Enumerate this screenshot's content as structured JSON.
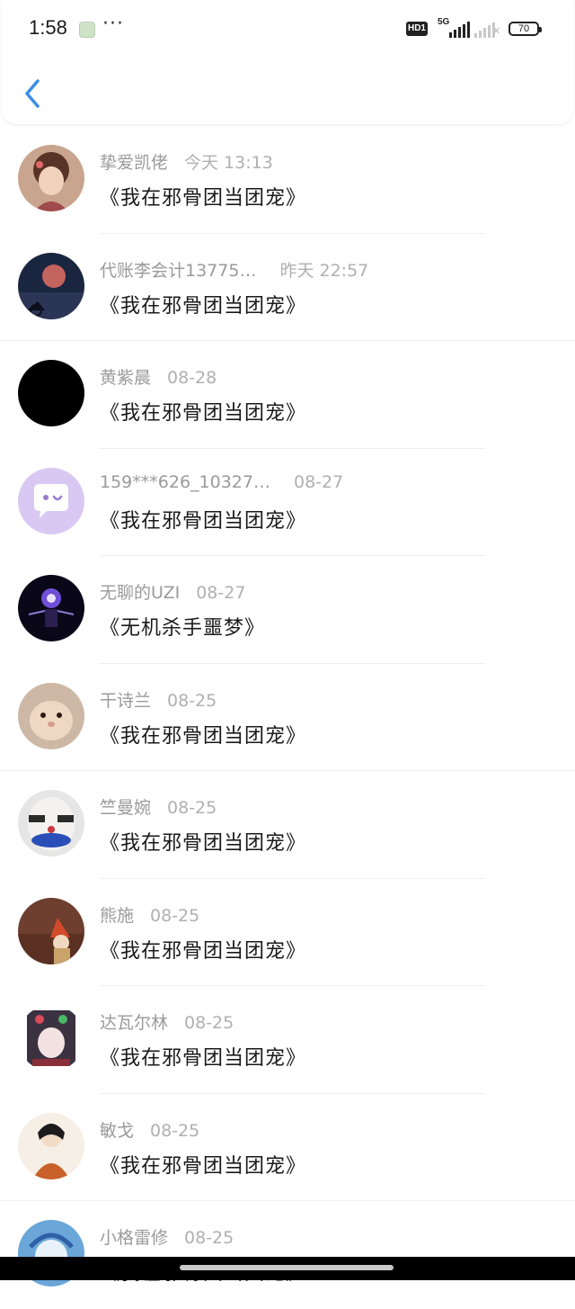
{
  "status_bar": {
    "time": "1:58",
    "dots": "···",
    "hd_label": "HD1",
    "network": "5G",
    "battery": "70"
  },
  "colors": {
    "back_arrow": "#3a8ee6",
    "name_text": "#9a9a9a",
    "title_text": "#1a1a1a"
  },
  "items": [
    {
      "name": "挚爱凯佬",
      "date": "今天 13:13",
      "title": "《我在邪骨团当团宠》"
    },
    {
      "name": "代账李会计13775…",
      "date": "昨天 22:57",
      "title": "《我在邪骨团当团宠》"
    },
    {
      "name": "黄紫晨",
      "date": "08-28",
      "title": "《我在邪骨团当团宠》"
    },
    {
      "name": "159***626_10327…",
      "date": "08-27",
      "title": "《我在邪骨团当团宠》"
    },
    {
      "name": "无聊的UZI",
      "date": "08-27",
      "title": "《无机杀手噩梦》"
    },
    {
      "name": "干诗兰",
      "date": "08-25",
      "title": "《我在邪骨团当团宠》"
    },
    {
      "name": "竺曼婉",
      "date": "08-25",
      "title": "《我在邪骨团当团宠》"
    },
    {
      "name": "熊施",
      "date": "08-25",
      "title": "《我在邪骨团当团宠》"
    },
    {
      "name": "达瓦尔林",
      "date": "08-25",
      "title": "《我在邪骨团当团宠》"
    },
    {
      "name": "敏戈",
      "date": "08-25",
      "title": "《我在邪骨团当团宠》"
    },
    {
      "name": "小格雷修",
      "date": "08-25",
      "title": "《我在邪骨团当团宠》"
    }
  ]
}
